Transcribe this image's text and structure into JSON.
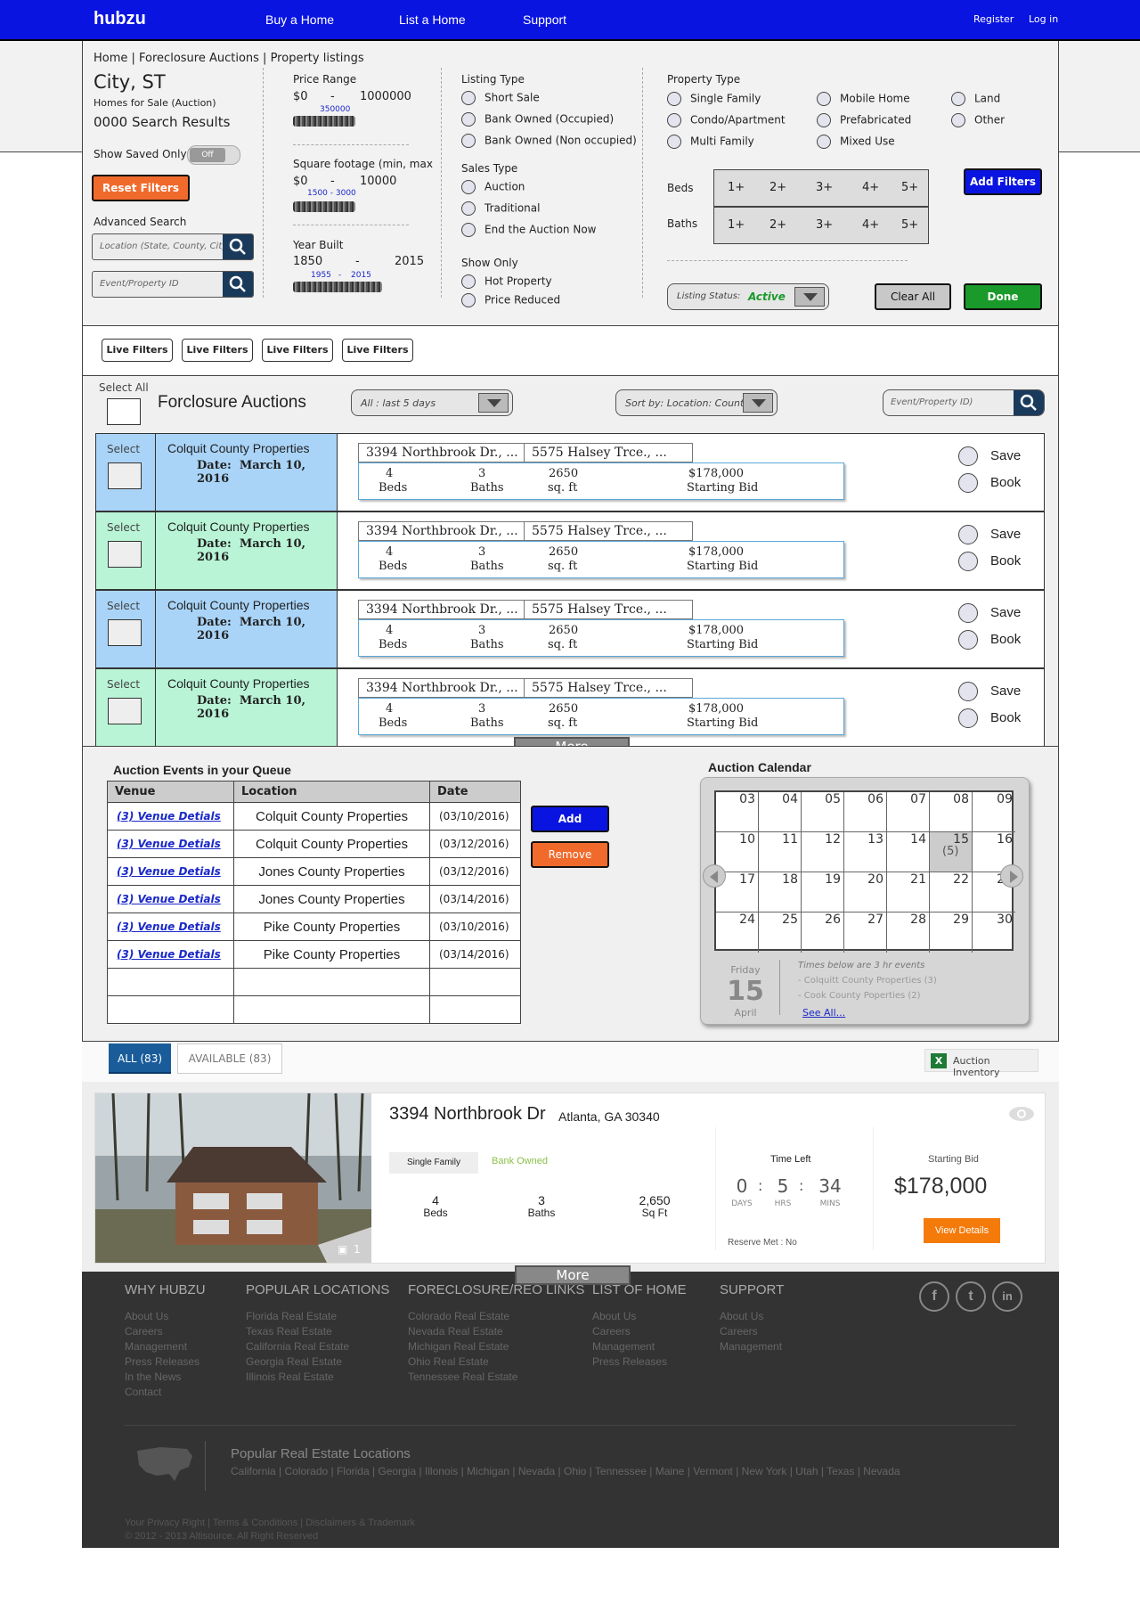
{
  "nav": {
    "logo": "hubzu",
    "links": [
      "Buy a Home",
      "List a Home",
      "Support"
    ],
    "register": "Register",
    "login": "Log in"
  },
  "filters": {
    "breadcrumb": "Home | Foreclosure Auctions | Property listings",
    "city": "City, ST",
    "subtitle": "Homes for Sale (Auction)",
    "results": "0000 Search Results",
    "show_saved": "Show Saved Only",
    "toggle": "Off",
    "reset": "Reset Filters",
    "advanced": "Advanced Search",
    "location_placeholder": "Location (State, County, City)",
    "event_placeholder": "Event/Property ID",
    "price": {
      "label": "Price Range",
      "min": "$0",
      "dash": "-",
      "max": "1000000",
      "sel": "350000"
    },
    "sqft": {
      "label": "Square footage (min, max",
      "min": "$0",
      "dash": "-",
      "max": "10000",
      "sel": "1500 - 3000"
    },
    "year": {
      "label": "Year Built",
      "min": "1850",
      "dash": "-",
      "max": "2015",
      "sel_a": "1955",
      "sel_dash": "-",
      "sel_b": "2015"
    },
    "listing_type": {
      "label": "Listing Type",
      "options": [
        "Short Sale",
        "Bank Owned (Occupied)",
        "Bank Owned (Non occupied)"
      ]
    },
    "sales_type": {
      "label": "Sales Type",
      "options": [
        "Auction",
        "Traditional",
        "End the Auction Now"
      ]
    },
    "show_only": {
      "label": "Show Only",
      "options": [
        "Hot Property",
        "Price Reduced"
      ]
    },
    "property_type": {
      "label": "Property Type",
      "options": [
        "Single Family",
        "Condo/Apartment",
        "Multi Family",
        "Mobile Home",
        "Prefabricated",
        "Mixed Use",
        "Land",
        "Other"
      ]
    },
    "beds": {
      "label": "Beds",
      "options": [
        "1+",
        "2+",
        "3+",
        "4+",
        "5+"
      ]
    },
    "baths": {
      "label": "Baths",
      "options": [
        "1+",
        "2+",
        "3+",
        "4+",
        "5+"
      ]
    },
    "add_filters": "Add Filters",
    "listing_status_label": "Listing Status:",
    "listing_status": "Active",
    "clear_all": "Clear All",
    "done": "Done"
  },
  "live_filters": [
    "Live Filters",
    "Live Filters",
    "Live Filters",
    "Live Filters"
  ],
  "listing": {
    "select_all": "Select All",
    "title": "Forclosure Auctions",
    "period": "All : last 5 days",
    "sort": "Sort by: Location: County",
    "search_placeholder": "Event/Property ID)",
    "rows": [
      {
        "select": "Select",
        "county": "Colquit County Properties",
        "date_label": "Date:",
        "date": "March 10, 2016",
        "addr1": "3394 Northbrook Dr., ...",
        "addr2": "5575 Halsey Trce., ...",
        "beds": "4",
        "beds_l": "Beds",
        "baths": "3",
        "baths_l": "Baths",
        "sqft": "2650",
        "sqft_l": "sq. ft",
        "bid": "$178,000",
        "bid_l": "Starting Bid",
        "save": "Save",
        "book": "Book",
        "color": "#a9d4f8"
      },
      {
        "select": "Select",
        "county": "Colquit County Properties",
        "date_label": "Date:",
        "date": "March 10, 2016",
        "addr1": "3394 Northbrook Dr., ...",
        "addr2": "5575 Halsey Trce., ...",
        "beds": "4",
        "beds_l": "Beds",
        "baths": "3",
        "baths_l": "Baths",
        "sqft": "2650",
        "sqft_l": "sq. ft",
        "bid": "$178,000",
        "bid_l": "Starting Bid",
        "save": "Save",
        "book": "Book",
        "color": "#b9f4d6"
      },
      {
        "select": "Select",
        "county": "Colquit County Properties",
        "date_label": "Date:",
        "date": "March 10, 2016",
        "addr1": "3394 Northbrook Dr., ...",
        "addr2": "5575 Halsey Trce., ...",
        "beds": "4",
        "beds_l": "Beds",
        "baths": "3",
        "baths_l": "Baths",
        "sqft": "2650",
        "sqft_l": "sq. ft",
        "bid": "$178,000",
        "bid_l": "Starting Bid",
        "save": "Save",
        "book": "Book",
        "color": "#a9d4f8"
      },
      {
        "select": "Select",
        "county": "Colquit County Properties",
        "date_label": "Date:",
        "date": "March 10, 2016",
        "addr1": "3394 Northbrook Dr., ...",
        "addr2": "5575 Halsey Trce., ...",
        "beds": "4",
        "beds_l": "Beds",
        "baths": "3",
        "baths_l": "Baths",
        "sqft": "2650",
        "sqft_l": "sq. ft",
        "bid": "$178,000",
        "bid_l": "Starting Bid",
        "save": "Save",
        "book": "Book",
        "color": "#b9f4d6"
      }
    ],
    "more": "More"
  },
  "queue": {
    "title": "Auction Events in your Queue",
    "headers": [
      "Venue",
      "Location",
      "Date"
    ],
    "rows": [
      [
        "(3) Venue Detials",
        "Colquit County Properties",
        "(03/10/2016)"
      ],
      [
        "(3) Venue Detials",
        "Colquit County Properties",
        "(03/12/2016)"
      ],
      [
        "(3) Venue Detials",
        "Jones County Properties",
        "(03/12/2016)"
      ],
      [
        "(3) Venue Detials",
        "Jones County Properties",
        "(03/14/2016)"
      ],
      [
        "(3) Venue Detials",
        "Pike County Properties",
        "(03/10/2016)"
      ],
      [
        "(3) Venue Detials",
        "Pike County Properties",
        "(03/14/2016)"
      ]
    ],
    "add": "Add",
    "remove": "Remove"
  },
  "calendar": {
    "title": "Auction Calendar",
    "days": [
      "03",
      "04",
      "05",
      "06",
      "07",
      "08",
      "09",
      "10",
      "11",
      "12",
      "13",
      "14",
      "15",
      "16",
      "17",
      "18",
      "19",
      "20",
      "21",
      "22",
      "23",
      "24",
      "25",
      "26",
      "27",
      "28",
      "29",
      "30"
    ],
    "highlight_count": "(5)",
    "weekday": "Friday",
    "day": "15",
    "month": "April",
    "note": "Times below are 3 hr events",
    "events": [
      "- Colquitt County Properties (3)",
      "- Cook County Poperties (2)"
    ],
    "see_all": "See All..."
  },
  "results": {
    "tab_all": "ALL (83)",
    "tab_available": "AVAILABLE (83)",
    "inventory": "Auction Inventory",
    "address": "3394 Northbrook Dr",
    "city": "Atlanta, GA 30340",
    "type": "Single Family",
    "status": "Bank Owned",
    "beds": "4",
    "beds_l": "Beds",
    "baths": "3",
    "baths_l": "Baths",
    "sqft": "2,650",
    "sqft_l": "Sq Ft",
    "time_left": "Time Left",
    "days": "0",
    "days_l": "DAYS",
    "hrs": "5",
    "hrs_l": "HRS",
    "mins": "34",
    "mins_l": "MINS",
    "reserve": "Reserve Met : No",
    "starting_bid_label": "Starting Bid",
    "starting_bid": "$178,000",
    "view": "View Details",
    "photo_count": "1",
    "more": "More"
  },
  "footer": {
    "cols": [
      {
        "title": "WHY HUBZU",
        "items": [
          "About Us",
          "Careers",
          "Management",
          "Press Releases",
          "In the News",
          "Contact"
        ]
      },
      {
        "title": "POPULAR LOCATIONS",
        "items": [
          "Florida Real Estate",
          "Texas Real Estate",
          "California Real Estate",
          "Georgia Real Estate",
          "Illinois Real Estate"
        ]
      },
      {
        "title": "FORECLOSURE/REO LINKS",
        "items": [
          "Colorado Real Estate",
          "Nevada Real Estate",
          "Michigan Real Estate",
          "Ohio Real Estate",
          "Tennessee Real Estate"
        ]
      },
      {
        "title": "LIST OF HOME",
        "items": [
          "About Us",
          "Careers",
          "Management",
          "Press Releases"
        ]
      },
      {
        "title": "SUPPORT",
        "items": [
          "About Us",
          "Careers",
          "Management"
        ]
      }
    ],
    "social": [
      "f",
      "t",
      "in"
    ],
    "popular_title": "Popular Real Estate Locations",
    "states": "California | Colorado | Florida | Georgia | Illonois | Michigan | Nevada | Ohio | Tennessee | Maine | Vermont | New York | Utah | Texas | Nevada",
    "legal1": "Your Privacy Right | Terms & Conditions | Disclaimers & Trademark",
    "legal2": "© 2012 - 2013 Altisource. All Right Reserved"
  }
}
